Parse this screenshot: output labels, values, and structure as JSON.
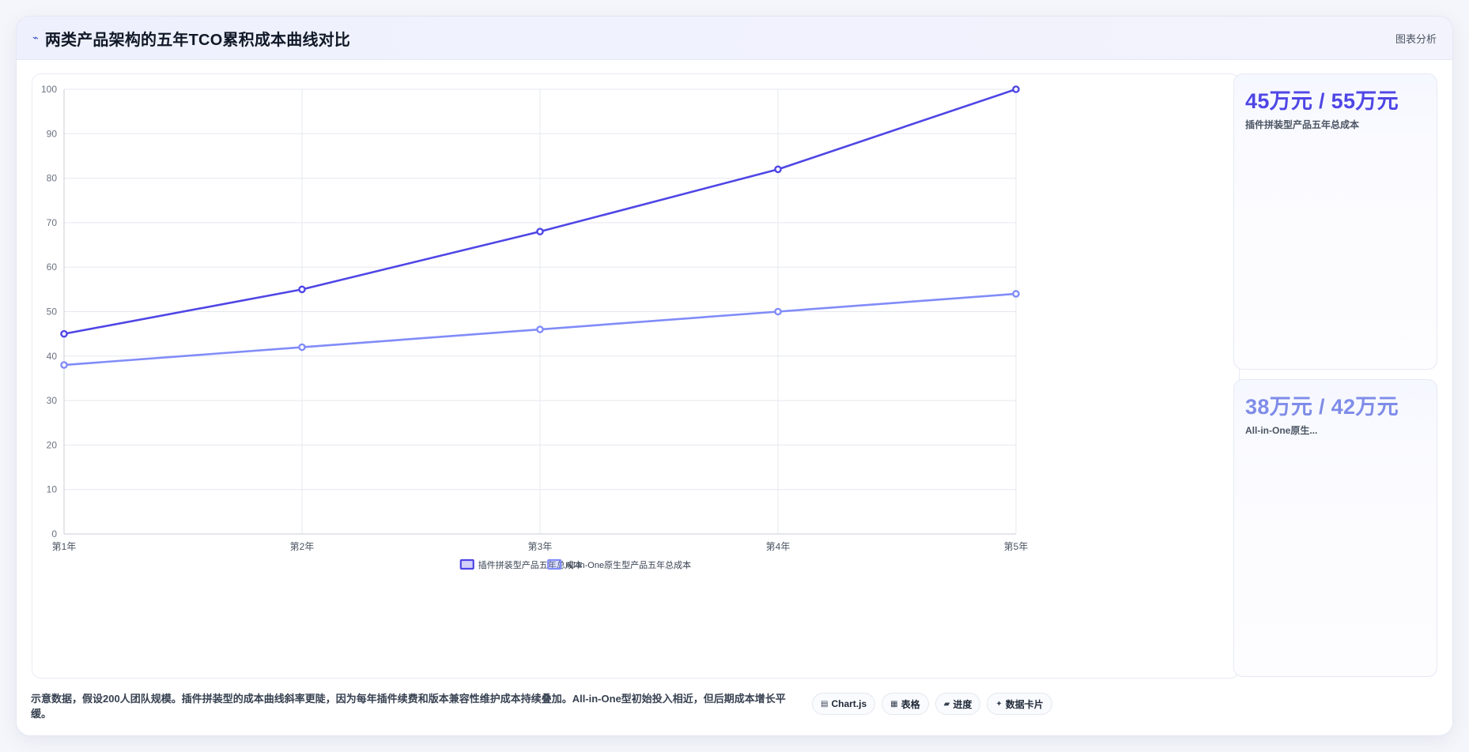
{
  "header": {
    "title": "两类产品架构的五年TCO累积成本曲线对比",
    "tag": "图表分析"
  },
  "chart_data": {
    "type": "line",
    "categories": [
      "第1年",
      "第2年",
      "第3年",
      "第4年",
      "第5年"
    ],
    "series": [
      {
        "name": "插件拼装型产品五年总成本",
        "values": [
          45,
          55,
          68,
          82,
          100
        ],
        "color": "#4f46e5"
      },
      {
        "name": "All-in-One原生型产品五年总成本",
        "values": [
          38,
          42,
          46,
          50,
          54
        ],
        "color": "#818cf8"
      }
    ],
    "ylim": [
      0,
      100
    ],
    "yticks": [
      0,
      10,
      20,
      30,
      40,
      50,
      60,
      70,
      80,
      90,
      100
    ],
    "grid": true,
    "legend": "bottom"
  },
  "side_cards": [
    {
      "value": "45万元 / 55万元",
      "label": "插件拼装型产品五年总成本"
    },
    {
      "value": "38万元 / 42万元",
      "label": "All-in-One原生..."
    }
  ],
  "footer": {
    "note": "示意数据，假设200人团队规模。插件拼装型的成本曲线斜率更陡，因为每年插件续费和版本兼容性维护成本持续叠加。All-in-One型初始投入相近，但后期成本增长平缓。",
    "chips": [
      {
        "icon": "▤",
        "label": "Chart.js"
      },
      {
        "icon": "▦",
        "label": "表格"
      },
      {
        "icon": "▰",
        "label": "进度"
      },
      {
        "icon": "✦",
        "label": "数据卡片"
      }
    ]
  }
}
